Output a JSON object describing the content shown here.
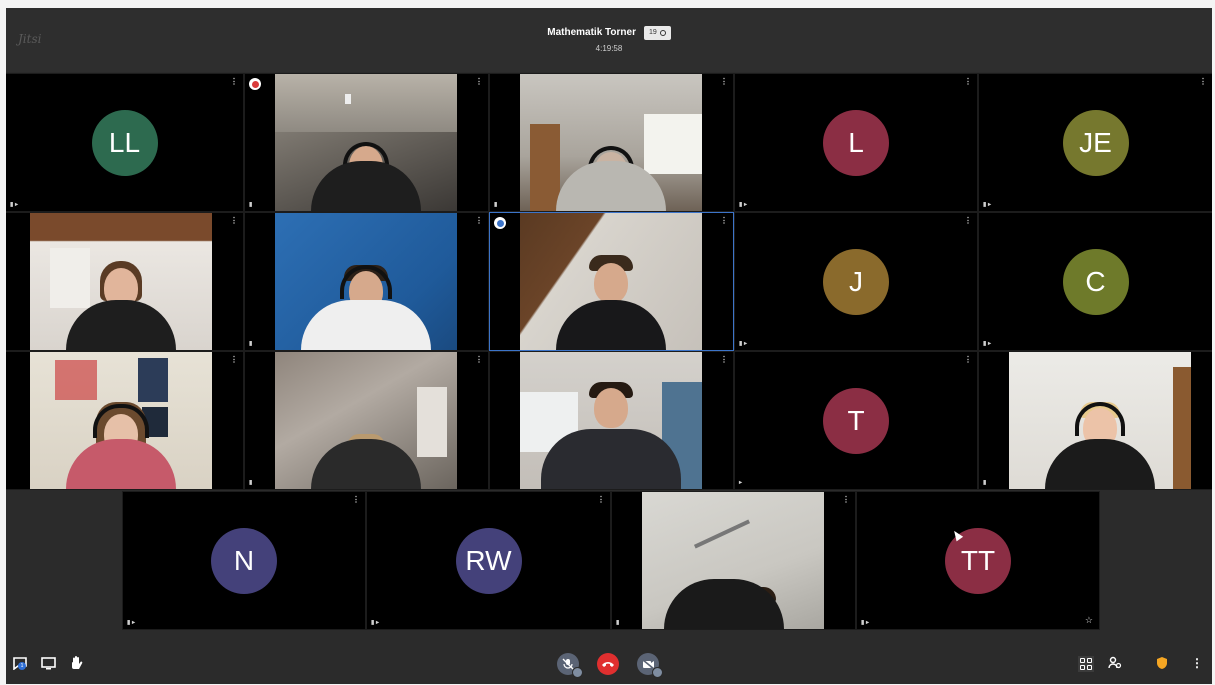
{
  "topbar": {
    "logo_text": "Jitsi",
    "meeting_title": "Mathematik Torner",
    "participant_count": "19",
    "timer": "4:19:58"
  },
  "tiles": {
    "r1c1": {
      "initials": "LL",
      "color": "#2d6a4f"
    },
    "r1c4": {
      "initials": "L",
      "color": "#8b2e44"
    },
    "r1c5": {
      "initials": "JE",
      "color": "#76782e"
    },
    "r2c4": {
      "initials": "J",
      "color": "#8a6a2c"
    },
    "r2c5": {
      "initials": "C",
      "color": "#6e7a2a"
    },
    "r3c4": {
      "initials": "T",
      "color": "#8b2e44"
    },
    "r4c1": {
      "initials": "N",
      "color": "#44417a"
    },
    "r4c2": {
      "initials": "RW",
      "color": "#44417a"
    },
    "r4c4": {
      "initials": "TT",
      "color": "#8b2e44"
    }
  },
  "toolbar": {
    "chat_badge": "1",
    "icons": {
      "chat": "chat-icon",
      "screenshare": "screen-share-icon",
      "raise_hand": "raise-hand-icon",
      "mic": "microphone-muted-icon",
      "hangup": "hangup-icon",
      "camera": "camera-muted-icon",
      "tile_view": "tile-view-icon",
      "participants": "participants-icon",
      "security": "security-shield-icon",
      "more": "more-options-icon"
    }
  }
}
